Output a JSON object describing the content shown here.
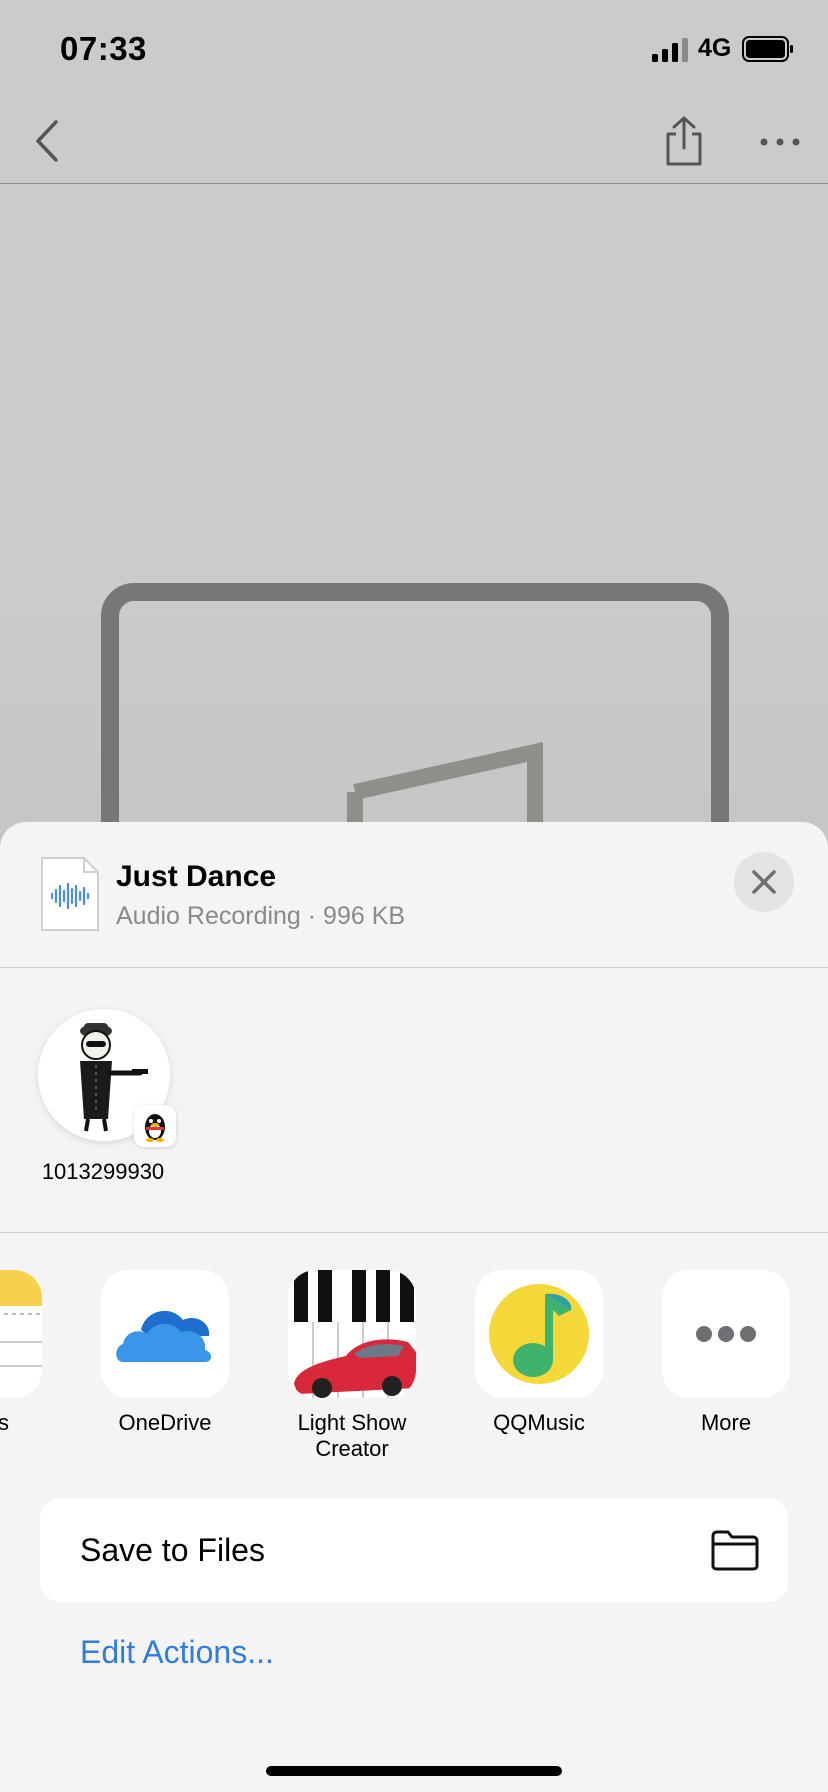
{
  "status_bar": {
    "time": "07:33",
    "network": "4G"
  },
  "share_sheet": {
    "file": {
      "title": "Just Dance",
      "subtitle": "Audio Recording · 996 KB"
    },
    "people": [
      {
        "name": "1013299930"
      }
    ],
    "apps": [
      {
        "label": "OneDrive"
      },
      {
        "label": "Light Show Creator"
      },
      {
        "label": "QQMusic"
      },
      {
        "label": "More"
      }
    ],
    "partial_app_label": "s",
    "actions": {
      "save_to_files": "Save to Files",
      "edit_actions": "Edit Actions..."
    }
  },
  "colors": {
    "accent": "#2f7de1",
    "sheet_bg": "#f4f4f4",
    "dimmed_bg": "#cbcbcb"
  }
}
